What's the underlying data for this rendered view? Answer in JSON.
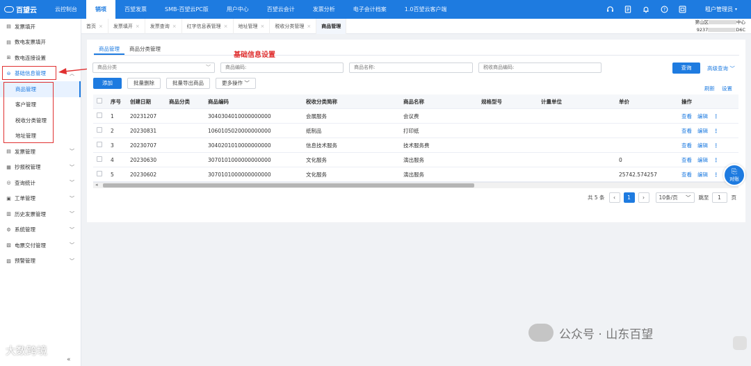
{
  "topbar": {
    "logo": "百望云",
    "nav": [
      "云控制台",
      "销项",
      "百望发票",
      "SMB-百望云PC版",
      "用户中心",
      "百望云会计",
      "发票分析",
      "电子会计档案",
      "1.0百望云客户端"
    ],
    "active_index": 1,
    "icons": [
      "headset-icon",
      "document-icon",
      "bell-icon",
      "help-icon",
      "calendar-icon"
    ],
    "user": "租户管理员"
  },
  "sidebar": {
    "items": [
      {
        "label": "发票填开",
        "icon": "invoice-icon"
      },
      {
        "label": "数电发票填开",
        "icon": "invoice-icon"
      },
      {
        "label": "数电连接设置",
        "icon": "grid-icon"
      }
    ],
    "group": {
      "label": "基础信息管理",
      "icon": "database-icon",
      "expanded": true
    },
    "sub_items": [
      "商品管理",
      "客户管理",
      "税收分类管理",
      "地址管理"
    ],
    "active_sub": "商品管理",
    "more_items": [
      {
        "label": "发票管理",
        "icon": "invoice-icon"
      },
      {
        "label": "抄报税管理",
        "icon": "calculator-icon"
      },
      {
        "label": "查询统计",
        "icon": "search-icon"
      },
      {
        "label": "工单管理",
        "icon": "ticket-icon"
      },
      {
        "label": "历史发票管理",
        "icon": "history-icon"
      },
      {
        "label": "系统管理",
        "icon": "gear-icon"
      },
      {
        "label": "电票交付管理",
        "icon": "send-icon"
      },
      {
        "label": "预警管理",
        "icon": "alert-icon"
      }
    ],
    "collapse": "«"
  },
  "page_tabs": [
    "首页",
    "发票填开",
    "发票查询",
    "红字信息表管理",
    "地址管理",
    "税收分类管理",
    "商品管理"
  ],
  "tenant": {
    "line1": "第山区",
    "line1_suffix": "中心",
    "line2": "9237",
    "line2_suffix": "D6C"
  },
  "annotation": "基础信息设置",
  "subtabs": [
    "商品管理",
    "商品分类管理"
  ],
  "filters": {
    "category_placeholder": "商品分类",
    "code_placeholder": "商品编码:",
    "name_placeholder": "商品名称:",
    "tax_code_placeholder": "税收商品编码:",
    "query": "查询",
    "advanced": "高级查询"
  },
  "actions": {
    "add": "添加",
    "batch_delete": "批量删除",
    "batch_export": "批量导出商品",
    "more": "更多操作"
  },
  "tools": {
    "refresh": "刷新",
    "settings": "设置"
  },
  "table": {
    "headers": [
      "序号",
      "创建日期",
      "商品分类",
      "商品编码",
      "税收分类简称",
      "商品名称",
      "规格型号",
      "计量单位",
      "单价",
      "操作"
    ],
    "rows": [
      {
        "no": "1",
        "date": "20231207",
        "category": "",
        "code": "3040304010000000000",
        "tax": "会展服务",
        "name": "会议费",
        "spec": "",
        "unit": "",
        "price": ""
      },
      {
        "no": "2",
        "date": "20230831",
        "category": "",
        "code": "1060105020000000000",
        "tax": "纸制品",
        "name": "打印纸",
        "spec": "",
        "unit": "",
        "price": ""
      },
      {
        "no": "3",
        "date": "20230707",
        "category": "",
        "code": "3040201010000000000",
        "tax": "信息技术服务",
        "name": "技术服务费",
        "spec": "",
        "unit": "",
        "price": ""
      },
      {
        "no": "4",
        "date": "20230630",
        "category": "",
        "code": "3070101000000000000",
        "tax": "文化服务",
        "name": "演出服务",
        "spec": "",
        "unit": "",
        "price": "0"
      },
      {
        "no": "5",
        "date": "20230602",
        "category": "",
        "code": "3070101000000000000",
        "tax": "文化服务",
        "name": "演出服务",
        "spec": "",
        "unit": "",
        "price": "25742.574257"
      }
    ],
    "row_ops": {
      "view": "查看",
      "edit": "编辑",
      "more": "⋮"
    }
  },
  "pagination": {
    "total": "共 5 条",
    "current": "1",
    "page_size": "10条/页",
    "jump_label": "跳至",
    "jump_value": "1",
    "page_unit": "页",
    "prev": "‹",
    "next": "›"
  },
  "float_button": "对账",
  "watermarks": {
    "wechat": "公众号 · 山东百望",
    "left": "大数跨境"
  },
  "colors": {
    "primary": "#1e7be0",
    "annotation": "#e03030"
  }
}
